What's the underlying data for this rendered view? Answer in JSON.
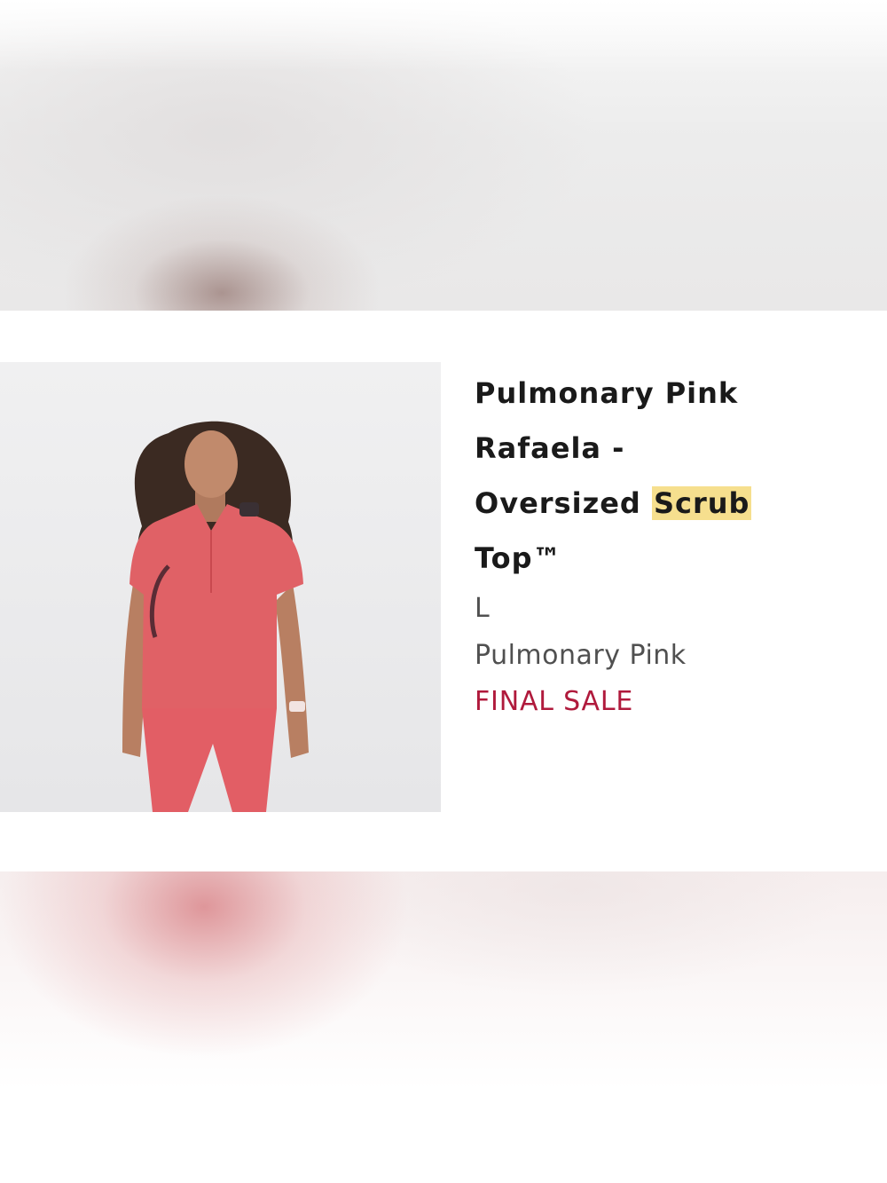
{
  "product": {
    "title_parts": {
      "line1": "Pulmonary Pink",
      "line2": "Rafaela -",
      "line3_pre": "Oversized ",
      "line3_highlight": "Scrub",
      "line4": "Top™"
    },
    "size": "L",
    "color": "Pulmonary Pink",
    "sale_label": "FINAL SALE"
  },
  "colors": {
    "highlight": "#f6df8e",
    "sale_text": "#b01a3c",
    "garment": "#e06166"
  },
  "icons": {
    "image": "product-photo"
  }
}
